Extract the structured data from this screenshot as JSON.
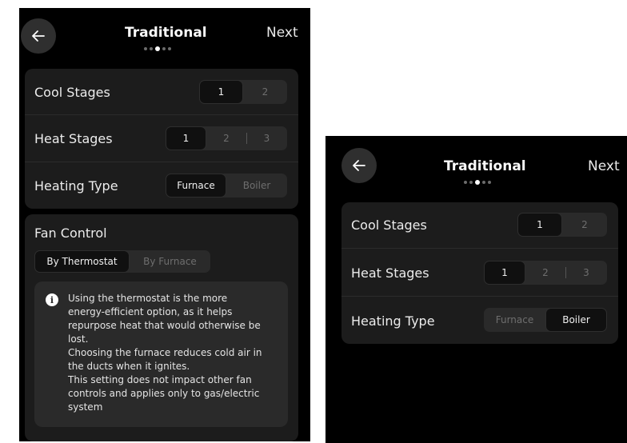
{
  "screen_a": {
    "header": {
      "title": "Traditional",
      "next_label": "Next",
      "step_count": 5,
      "active_step": 3
    },
    "cool_stages": {
      "label": "Cool Stages",
      "options": [
        "1",
        "2"
      ],
      "selected": "1"
    },
    "heat_stages": {
      "label": "Heat Stages",
      "options": [
        "1",
        "2",
        "3"
      ],
      "selected": "1"
    },
    "heating_type": {
      "label": "Heating Type",
      "options": [
        "Furnace",
        "Boiler"
      ],
      "selected": "Furnace"
    },
    "fan_control": {
      "title": "Fan Control",
      "options": [
        "By Thermostat",
        "By Furnace"
      ],
      "selected": "By Thermostat",
      "info_lines": [
        "Using the thermostat is the more",
        "energy-efficient option, as it helps",
        "repurpose heat that would otherwise be",
        "lost.",
        "Choosing the furnace reduces cold air in",
        "the ducts when it ignites.",
        "This setting does not impact other fan",
        "controls and applies only to gas/electric",
        "system"
      ]
    }
  },
  "screen_b": {
    "header": {
      "title": "Traditional",
      "next_label": "Next",
      "step_count": 5,
      "active_step": 3
    },
    "cool_stages": {
      "label": "Cool Stages",
      "options": [
        "1",
        "2"
      ],
      "selected": "1"
    },
    "heat_stages": {
      "label": "Heat Stages",
      "options": [
        "1",
        "2",
        "3"
      ],
      "selected": "1"
    },
    "heating_type": {
      "label": "Heating Type",
      "options": [
        "Furnace",
        "Boiler"
      ],
      "selected": "Boiler"
    }
  },
  "icons": {
    "back": "arrow-left-icon",
    "info": "info-icon"
  },
  "colors": {
    "background": "#000000",
    "card": "#1c1c1c",
    "segment_track": "#2a2a2a",
    "segment_selected": "#101010"
  }
}
